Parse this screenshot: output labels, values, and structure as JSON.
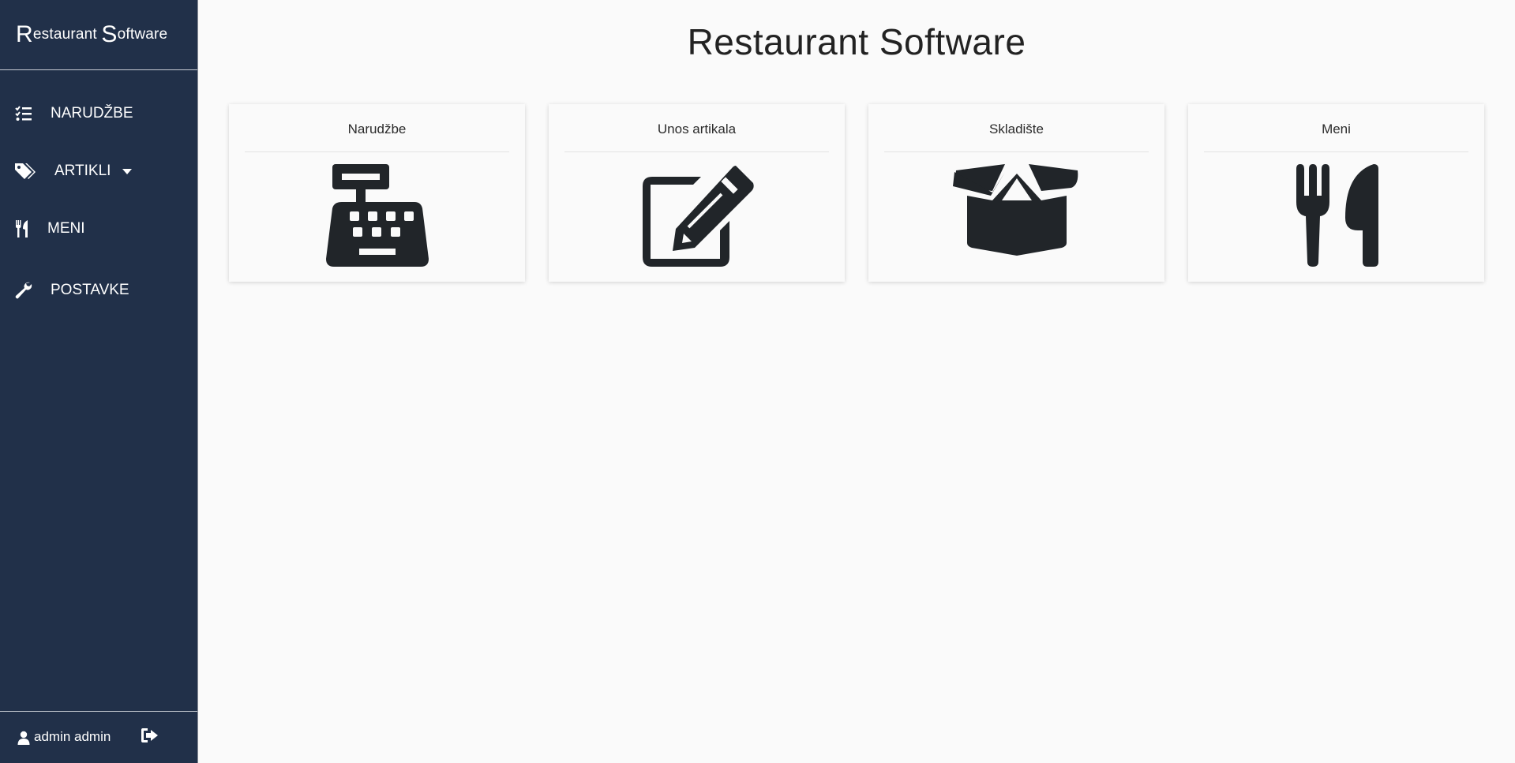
{
  "brand": {
    "first_initial": "R",
    "first_rest": "estaurant",
    "second_initial": "S",
    "second_rest": "oftware"
  },
  "nav": {
    "items": [
      {
        "label": "NARUDŽBE",
        "icon": "list-check-icon"
      },
      {
        "label": "ARTIKLI",
        "icon": "tags-icon"
      },
      {
        "label": "MENI",
        "icon": "utensils-icon"
      },
      {
        "label": "POSTAVKE",
        "icon": "wrench-icon"
      }
    ]
  },
  "user": {
    "name": "admin admin",
    "icon": "user-icon",
    "logout_icon": "logout-icon"
  },
  "main": {
    "title": "Restaurant Software",
    "cards": [
      {
        "title": "Narudžbe",
        "icon": "cash-register-icon"
      },
      {
        "title": "Unos artikala",
        "icon": "edit-icon"
      },
      {
        "title": "Skladište",
        "icon": "box-open-icon"
      },
      {
        "title": "Meni",
        "icon": "utensils-icon"
      }
    ]
  },
  "colors": {
    "sidebar_bg": "#213049",
    "page_bg": "#fafafa",
    "icon_dark": "#212529",
    "text_light": "#ffffff"
  }
}
